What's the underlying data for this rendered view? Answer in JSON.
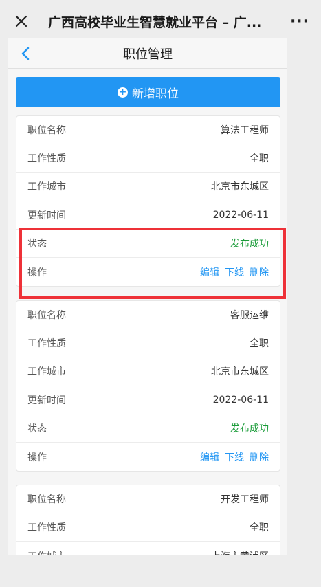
{
  "window": {
    "title": "广西高校毕业生智慧就业平台 – 广...",
    "more": "···"
  },
  "nav": {
    "title": "职位管理"
  },
  "add_button": {
    "label": "新增职位"
  },
  "labels": {
    "name": "职位名称",
    "type": "工作性质",
    "city": "工作城市",
    "updated": "更新时间",
    "status": "状态",
    "actions": "操作"
  },
  "actions": {
    "edit": "编辑",
    "offline": "下线",
    "delete": "删除"
  },
  "jobs": [
    {
      "name": "算法工程师",
      "type": "全职",
      "city": "北京市东城区",
      "updated": "2022-06-11",
      "status": "发布成功"
    },
    {
      "name": "客服运维",
      "type": "全职",
      "city": "北京市东城区",
      "updated": "2022-06-11",
      "status": "发布成功"
    },
    {
      "name": "开发工程师",
      "type": "全职",
      "city": "上海市黄浦区"
    }
  ],
  "colors": {
    "primary": "#2296f3",
    "success": "#1b9c3a",
    "highlight": "#ee3138"
  }
}
